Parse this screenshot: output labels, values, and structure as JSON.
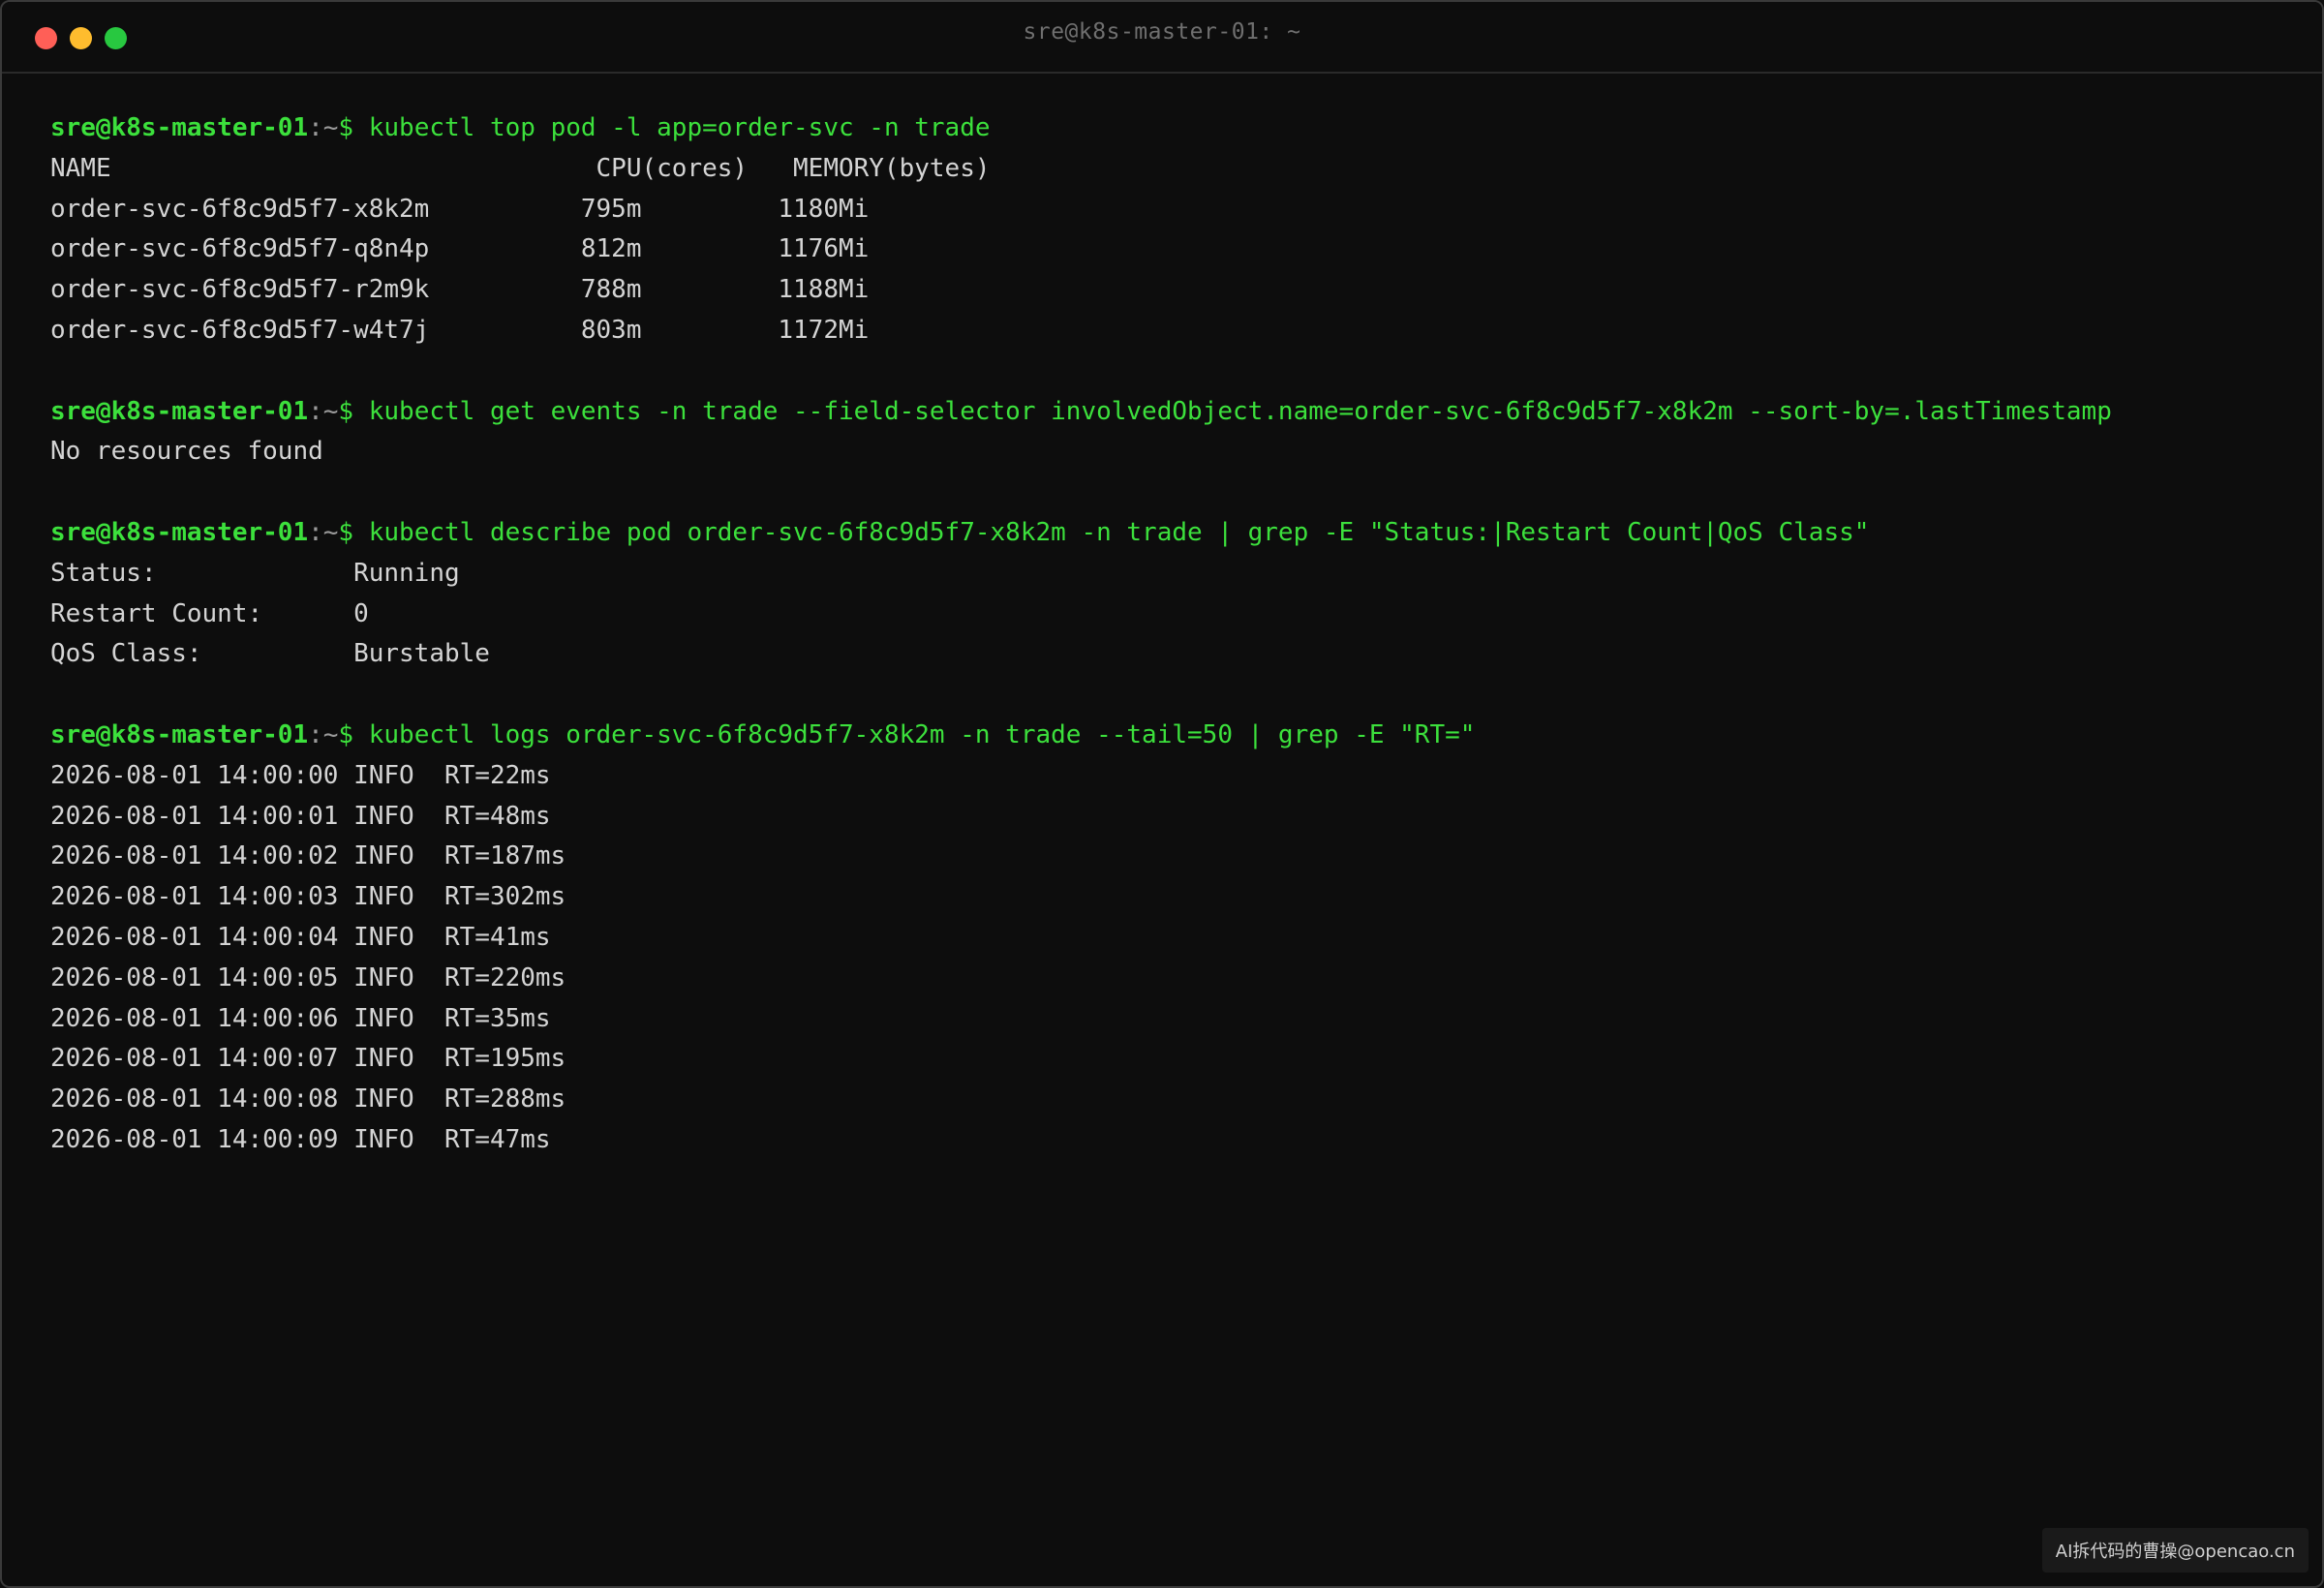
{
  "window": {
    "title": "sre@k8s-master-01: ~",
    "colors": {
      "close": "#ff5f57",
      "minimize": "#febc2e",
      "maximize": "#28c840"
    }
  },
  "prompt": {
    "user_host": "sre@k8s-master-01",
    "cwd": ":~",
    "dollar": "$"
  },
  "commands": [
    {
      "cmd": " kubectl top pod -l app=order-svc -n trade",
      "output": [
        "NAME                                CPU(cores)   MEMORY(bytes)",
        "order-svc-6f8c9d5f7-x8k2m          795m         1180Mi",
        "order-svc-6f8c9d5f7-q8n4p          812m         1176Mi",
        "order-svc-6f8c9d5f7-r2m9k          788m         1188Mi",
        "order-svc-6f8c9d5f7-w4t7j          803m         1172Mi"
      ]
    },
    {
      "cmd": " kubectl get events -n trade --field-selector involvedObject.name=order-svc-6f8c9d5f7-x8k2m --sort-by=.lastTimestamp",
      "output": [
        "No resources found"
      ]
    },
    {
      "cmd": " kubectl describe pod order-svc-6f8c9d5f7-x8k2m -n trade | grep -E \"Status:|Restart Count|QoS Class\"",
      "output": [
        "Status:             Running",
        "Restart Count:      0",
        "QoS Class:          Burstable"
      ]
    },
    {
      "cmd": " kubectl logs order-svc-6f8c9d5f7-x8k2m -n trade --tail=50 | grep -E \"RT=\"",
      "output": [
        "2026-08-01 14:00:00 INFO  RT=22ms",
        "2026-08-01 14:00:01 INFO  RT=48ms",
        "2026-08-01 14:00:02 INFO  RT=187ms",
        "2026-08-01 14:00:03 INFO  RT=302ms",
        "2026-08-01 14:00:04 INFO  RT=41ms",
        "2026-08-01 14:00:05 INFO  RT=220ms",
        "2026-08-01 14:00:06 INFO  RT=35ms",
        "2026-08-01 14:00:07 INFO  RT=195ms",
        "2026-08-01 14:00:08 INFO  RT=288ms",
        "2026-08-01 14:00:09 INFO  RT=47ms"
      ]
    }
  ],
  "watermark": "AI拆代码的曹操@opencao.cn"
}
